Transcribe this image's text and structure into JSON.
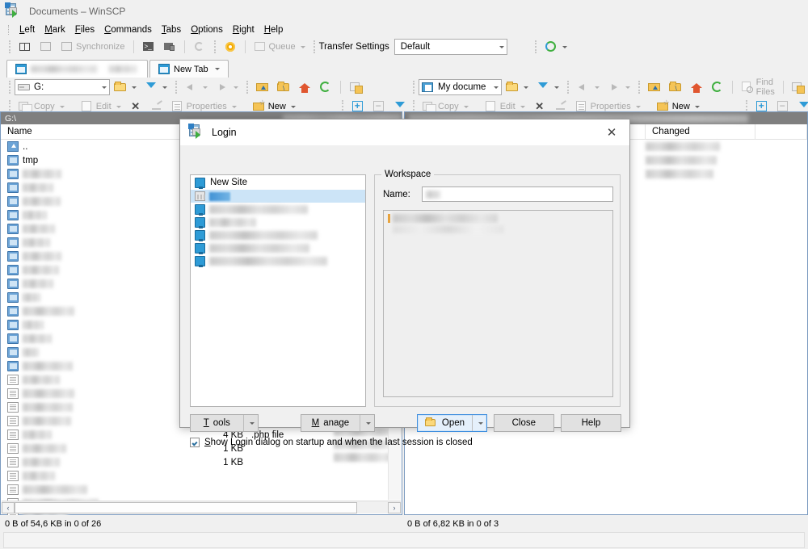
{
  "window": {
    "title": "Documents – WinSCP",
    "app_icon": "winscp-icon"
  },
  "menubar": {
    "items": [
      {
        "label": "Left",
        "accel": "L"
      },
      {
        "label": "Mark",
        "accel": "M"
      },
      {
        "label": "Files",
        "accel": "F"
      },
      {
        "label": "Commands",
        "accel": "C"
      },
      {
        "label": "Tabs",
        "accel": "T"
      },
      {
        "label": "Options",
        "accel": "O"
      },
      {
        "label": "Right",
        "accel": "R"
      },
      {
        "label": "Help",
        "accel": "H"
      }
    ]
  },
  "main_toolbar": {
    "synchronize_label": "Synchronize",
    "queue_label": "Queue",
    "transfer_settings_label": "Transfer Settings",
    "transfer_settings_value": "Default",
    "icons": [
      "split-panes-icon",
      "synchronize-browsing-icon",
      "synchronize-icon",
      "open-terminal-icon",
      "open-in-putty-icon",
      "refresh-icon",
      "preferences-gear-icon",
      "queue-icon",
      "transfer-settings-icon"
    ]
  },
  "tabbar": {
    "session_tab_label": "",
    "new_tab_label": "New Tab"
  },
  "left_panel": {
    "location_value": "G:",
    "location_icon": "drive-icon",
    "path": "G:\\",
    "toolbar": {
      "copy_label": "Copy",
      "edit_label": "Edit",
      "properties_label": "Properties",
      "new_label": "New",
      "delete_icon": "delete-x-icon",
      "rename_icon": "rename-pencil-icon",
      "icons": [
        "open-directory-icon",
        "filter-icon",
        "back-icon",
        "forward-icon",
        "parent-directory-icon",
        "root-directory-icon",
        "home-directory-icon",
        "refresh-icon",
        "add-bookmark-icon",
        "select-add-icon",
        "select-remove-icon",
        "select-filter-icon"
      ]
    },
    "columns": [
      "Name"
    ],
    "rows": [
      {
        "icon": "parent-directory-icon",
        "name": "..",
        "redacted": false,
        "blur_width": 0
      },
      {
        "icon": "folder-icon",
        "name": "tmp",
        "redacted": false,
        "blur_width": 0
      },
      {
        "icon": "folder-icon",
        "name": "",
        "redacted": true,
        "blur_width": 48
      },
      {
        "icon": "folder-icon",
        "name": "",
        "redacted": true,
        "blur_width": 38
      },
      {
        "icon": "folder-icon",
        "name": "",
        "redacted": true,
        "blur_width": 47
      },
      {
        "icon": "folder-icon",
        "name": "",
        "redacted": true,
        "blur_width": 30
      },
      {
        "icon": "folder-icon",
        "name": "",
        "redacted": true,
        "blur_width": 40
      },
      {
        "icon": "folder-icon",
        "name": "",
        "redacted": true,
        "blur_width": 34
      },
      {
        "icon": "folder-icon",
        "name": "",
        "redacted": true,
        "blur_width": 48
      },
      {
        "icon": "folder-icon",
        "name": "",
        "redacted": true,
        "blur_width": 45
      },
      {
        "icon": "folder-icon",
        "name": "",
        "redacted": true,
        "blur_width": 38
      },
      {
        "icon": "folder-icon",
        "name": "",
        "redacted": true,
        "blur_width": 22
      },
      {
        "icon": "folder-icon",
        "name": "",
        "redacted": true,
        "blur_width": 64
      },
      {
        "icon": "folder-icon",
        "name": "",
        "redacted": true,
        "blur_width": 26
      },
      {
        "icon": "folder-icon",
        "name": "",
        "redacted": true,
        "blur_width": 36
      },
      {
        "icon": "folder-icon",
        "name": "",
        "redacted": true,
        "blur_width": 20
      },
      {
        "icon": "folder-icon",
        "name": "",
        "redacted": true,
        "blur_width": 62
      },
      {
        "icon": "file-icon",
        "name": "",
        "redacted": true,
        "blur_width": 46
      },
      {
        "icon": "file-icon",
        "name": "",
        "redacted": true,
        "blur_width": 64
      },
      {
        "icon": "file-icon",
        "name": "",
        "redacted": true,
        "blur_width": 62
      },
      {
        "icon": "file-icon",
        "name": "",
        "redacted": true,
        "blur_width": 60
      },
      {
        "icon": "file-icon",
        "name": "",
        "redacted": true,
        "blur_width": 36
      },
      {
        "icon": "file-icon",
        "name": "",
        "redacted": true,
        "blur_width": 54
      },
      {
        "icon": "file-icon",
        "name": "",
        "redacted": true,
        "blur_width": 46
      },
      {
        "icon": "file-icon",
        "name": "",
        "redacted": true,
        "blur_width": 40
      },
      {
        "icon": "file-icon",
        "name": "",
        "redacted": true,
        "blur_width": 80
      },
      {
        "icon": "file-icon",
        "name": "",
        "redacted": true,
        "blur_width": 94
      },
      {
        "icon": "file-icon",
        "name": "",
        "redacted": true,
        "blur_width": 56
      }
    ],
    "visible_sizes": [
      {
        "size": "4 KB",
        "type": ".php file"
      },
      {
        "size": "1 KB",
        "type": ""
      },
      {
        "size": "1 KB",
        "type": ""
      }
    ],
    "status": "0 B of 54,6 KB in 0 of 26"
  },
  "right_panel": {
    "location_value": "My docume",
    "location_icon": "my-documents-icon",
    "toolbar": {
      "copy_label": "Copy",
      "edit_label": "Edit",
      "properties_label": "Properties",
      "new_label": "New",
      "find_files_label": "Find Files"
    },
    "columns": [
      "Changed"
    ],
    "status": "0 B of 6,82 KB in 0 of 3"
  },
  "login_dialog": {
    "title": "Login",
    "icon": "winscp-icon",
    "close_label": "✕",
    "new_site_label": "New Site",
    "new_site_icon": "new-site-icon",
    "sites": [
      {
        "icon": "folder-icon",
        "selected": true,
        "blur_width": 26
      },
      {
        "icon": "site-icon",
        "selected": false,
        "blur_width": 122
      },
      {
        "icon": "site-icon",
        "selected": false,
        "blur_width": 58
      },
      {
        "icon": "site-icon",
        "selected": false,
        "blur_width": 134
      },
      {
        "icon": "site-icon",
        "selected": false,
        "blur_width": 124
      },
      {
        "icon": "site-icon",
        "selected": false,
        "blur_width": 146
      }
    ],
    "workspace": {
      "group_label": "Workspace",
      "name_label": "Name:",
      "name_value": "",
      "name_blur_width": 18,
      "list_rows": [
        {
          "blur_width": 130
        },
        {
          "blur_width": 138
        }
      ]
    },
    "buttons": {
      "tools": {
        "label": "Tools",
        "accel": "T",
        "has_dropdown": true
      },
      "manage": {
        "label": "Manage",
        "accel": "M",
        "has_dropdown": true
      },
      "open": {
        "label": "Open",
        "icon": "open-folder-icon",
        "has_dropdown": true,
        "primary": true
      },
      "close": {
        "label": "Close"
      },
      "help": {
        "label": "Help"
      }
    },
    "checkbox": {
      "checked": true,
      "label": "how Login dialog on startup and when the last session is closed",
      "accel": "S"
    }
  }
}
